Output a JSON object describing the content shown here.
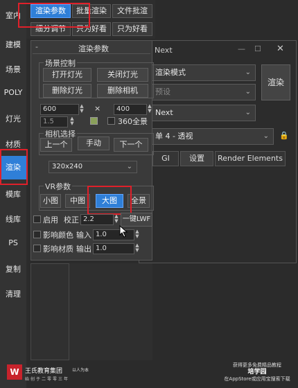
{
  "sidebar": {
    "items": [
      {
        "label": "室内"
      },
      {
        "label": "建模"
      },
      {
        "label": "场景"
      },
      {
        "label": "POLY"
      },
      {
        "label": "灯光"
      },
      {
        "label": "材质"
      },
      {
        "label": "渲染"
      },
      {
        "label": "模库"
      },
      {
        "label": "线库"
      },
      {
        "label": "PS"
      },
      {
        "label": "复制"
      },
      {
        "label": "清理"
      }
    ],
    "active_index": 6
  },
  "toolbar": {
    "row1": [
      "渲染参数",
      "批量渲染",
      "文件批渲"
    ],
    "row2": [
      "细分调节",
      "只为好看",
      "只为好看"
    ]
  },
  "panel": {
    "title": "渲染参数",
    "collapse": "-",
    "scene": {
      "title": "场景控制",
      "buttons": [
        "打开灯光",
        "关闭灯光",
        "删除灯光",
        "删除相机"
      ]
    },
    "size": {
      "width": "600",
      "height": "400",
      "times": "×",
      "ratio": "1.5",
      "pano_label": "360全景"
    },
    "camera": {
      "title": "相机选择",
      "buttons": [
        "上一个",
        "手动",
        "下一个"
      ]
    },
    "resolution": "320x240",
    "vr": {
      "title": "VR参数",
      "buttons": [
        "小图",
        "中图",
        "大图",
        "全景"
      ],
      "active_index": 2
    },
    "enable_label": "启用",
    "correct_label": "校正",
    "correct_value": "2.2",
    "lwf_button": "一键LWF",
    "affect_color_label": "影响颜色",
    "input_label": "输入",
    "input_value": "1.0",
    "affect_material_label": "影响材质",
    "output_label": "输出",
    "output_value": "1.0"
  },
  "bg_window": {
    "title": "Next",
    "render_mode": "渲染模式",
    "preset": "预设",
    "render_button": "渲染",
    "renderer": "Next",
    "view": "单 4 - 透视",
    "tabs": [
      "GI",
      "设置",
      "Render Elements"
    ]
  },
  "watermark": {
    "left_name": "王氏教育集团",
    "left_sub": "以人为本",
    "left_sub2": "始创于二零零三年",
    "right_line1": "获得更多免费精品教程",
    "right_app": "培学园",
    "right_line3": "在AppStore或应用宝搜索下载"
  }
}
